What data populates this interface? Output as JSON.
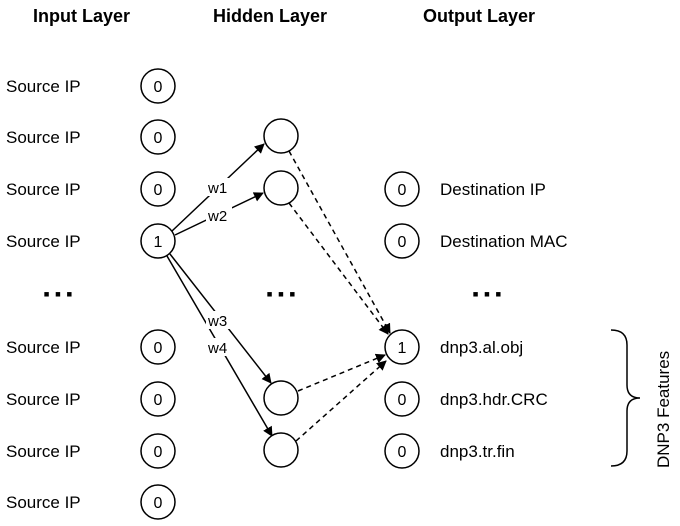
{
  "headers": {
    "input": "Input Layer",
    "hidden": "Hidden Layer",
    "output": "Output Layer"
  },
  "input_nodes": [
    {
      "label": "Source IP",
      "value": "0"
    },
    {
      "label": "Source IP",
      "value": "0"
    },
    {
      "label": "Source IP",
      "value": "0"
    },
    {
      "label": "Source IP",
      "value": "1"
    },
    {
      "label": "Source IP",
      "value": "0"
    },
    {
      "label": "Source IP",
      "value": "0"
    },
    {
      "label": "Source IP",
      "value": "0"
    },
    {
      "label": "Source IP",
      "value": "0"
    }
  ],
  "output_nodes": [
    {
      "label": "Destination IP",
      "value": "0"
    },
    {
      "label": "Destination MAC",
      "value": "0"
    },
    {
      "label": "dnp3.al.obj",
      "value": "1"
    },
    {
      "label": "dnp3.hdr.CRC",
      "value": "0"
    },
    {
      "label": "dnp3.tr.fin",
      "value": "0"
    }
  ],
  "ellipsis": "▪ ▪ ▪",
  "weights": [
    "w1",
    "w2",
    "w3",
    "w4"
  ],
  "group_label": "DNP3 Features",
  "hidden_node_count_shown": 4
}
